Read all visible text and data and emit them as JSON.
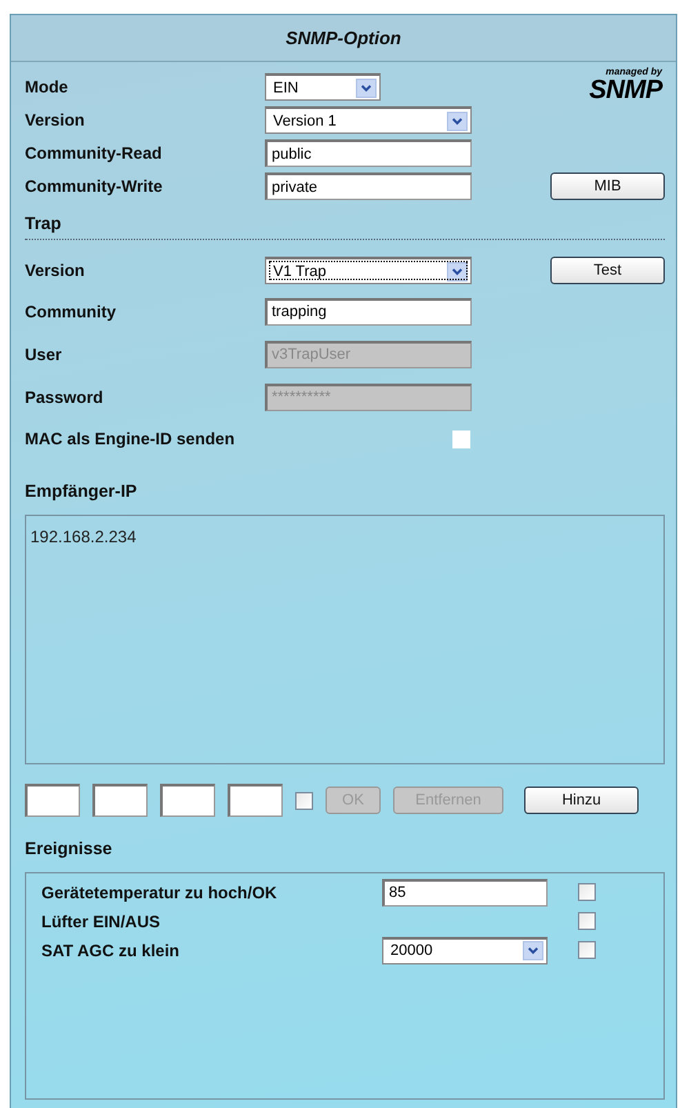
{
  "title": "SNMP-Option",
  "logo": {
    "tagline": "managed by",
    "name": "SNMP"
  },
  "settings": [
    {
      "kind": "select",
      "label": "Mode",
      "value": "EIN"
    },
    {
      "kind": "select",
      "label": "Version",
      "value": "Version 1"
    },
    {
      "kind": "text",
      "label": "Community-Read",
      "value": "public"
    },
    {
      "kind": "text",
      "label": "Community-Write",
      "value": "private",
      "button": "MIB"
    }
  ],
  "trap": {
    "heading": "Trap",
    "rows": [
      {
        "kind": "select",
        "label": "Version",
        "value": "V1 Trap",
        "focused": true,
        "button": "Test"
      },
      {
        "kind": "text",
        "label": "Community",
        "value": "trapping"
      },
      {
        "kind": "text",
        "label": "User",
        "value": "v3TrapUser",
        "disabled": true
      },
      {
        "kind": "text",
        "label": "Password",
        "value": "**********",
        "disabled": true
      }
    ],
    "mac": {
      "label": "MAC als Engine-ID senden",
      "checked": false
    }
  },
  "receivers": {
    "heading": "Empfänger-IP",
    "items": [
      "192.168.2.234"
    ],
    "ip_checked": false,
    "buttons": [
      {
        "label": "OK",
        "disabled": true
      },
      {
        "label": "Entfernen",
        "disabled": true
      },
      {
        "label": "Hinzu",
        "disabled": false
      }
    ]
  },
  "events": {
    "heading": "Ereignisse",
    "rows": [
      {
        "label": "Gerätetemperatur zu hoch/OK",
        "kind": "text",
        "value": "85",
        "checked": false
      },
      {
        "label": "Lüfter EIN/AUS",
        "kind": "none",
        "checked": false
      },
      {
        "label": "SAT AGC zu klein",
        "kind": "select",
        "value": "20000",
        "checked": false
      }
    ]
  }
}
